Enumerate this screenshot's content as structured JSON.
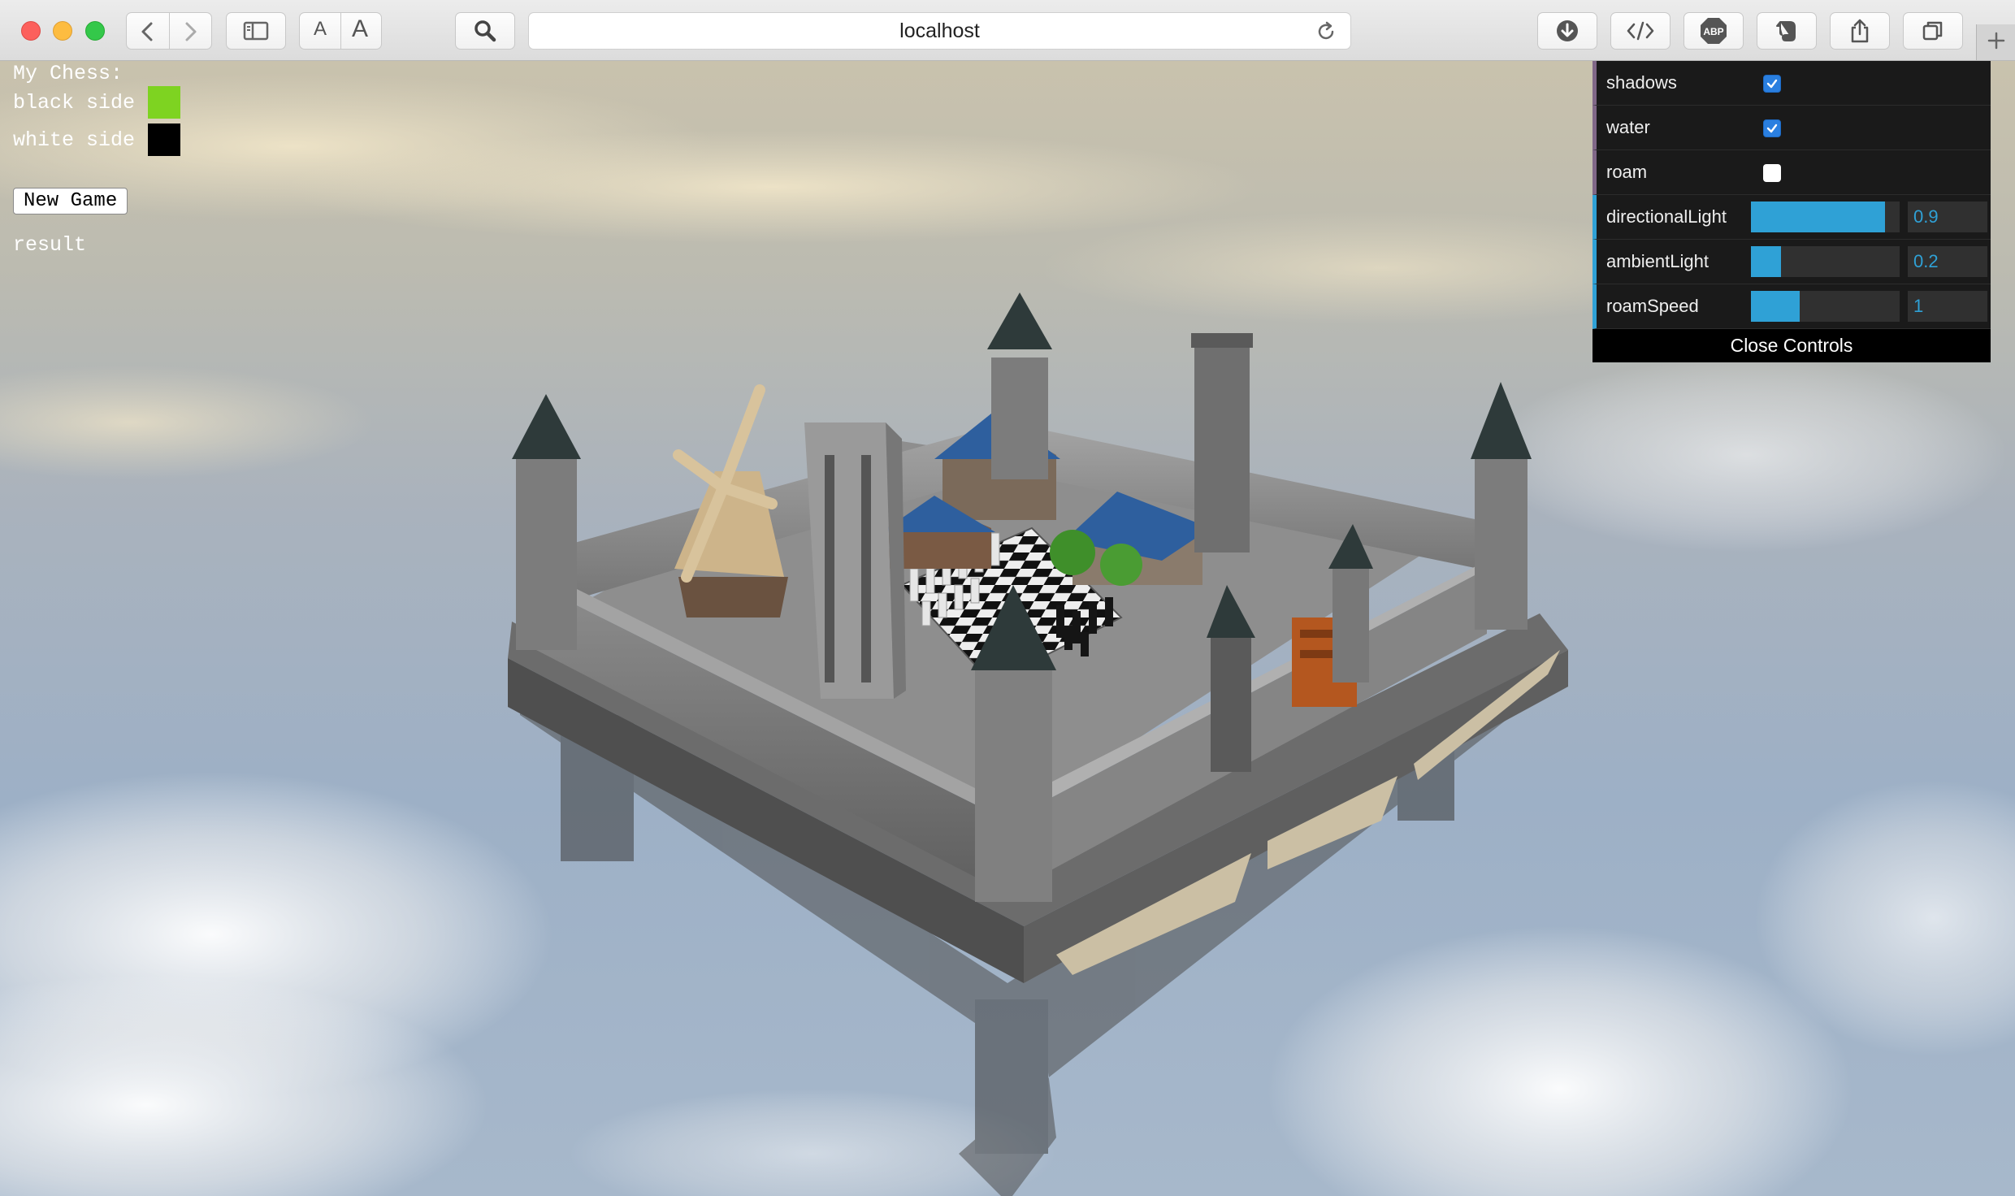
{
  "browser": {
    "url": "localhost",
    "aa_small": "A",
    "aa_large": "A",
    "icons": [
      "back-icon",
      "forward-icon",
      "sidebar-icon",
      "search-icon",
      "reload-icon",
      "download-icon",
      "code-icon",
      "adblock-icon",
      "evernote-icon",
      "share-icon",
      "tabs-icon",
      "plus-icon"
    ],
    "abp_label": "ABP"
  },
  "chess": {
    "title": "My Chess:",
    "black_side_label": "black side",
    "black_side_color": "#7ed321",
    "white_side_label": "white side",
    "white_side_color": "#000000",
    "new_game_label": "New Game",
    "result_label": "result"
  },
  "controls": {
    "shadows": {
      "label": "shadows",
      "checked": true
    },
    "water": {
      "label": "water",
      "checked": true
    },
    "roam": {
      "label": "roam",
      "checked": false
    },
    "directionalLight": {
      "label": "directionalLight",
      "value": "0.9",
      "fraction": 0.9
    },
    "ambientLight": {
      "label": "ambientLight",
      "value": "0.2",
      "fraction": 0.2
    },
    "roamSpeed": {
      "label": "roamSpeed",
      "value": "1",
      "fraction": 0.33
    },
    "close_label": "Close Controls"
  },
  "colors": {
    "gui_accent": "#2fa1d6",
    "gui_bool_accent": "#806787",
    "castle_stone": "#7a7a7a",
    "roof_blue": "#2e5f9e"
  }
}
